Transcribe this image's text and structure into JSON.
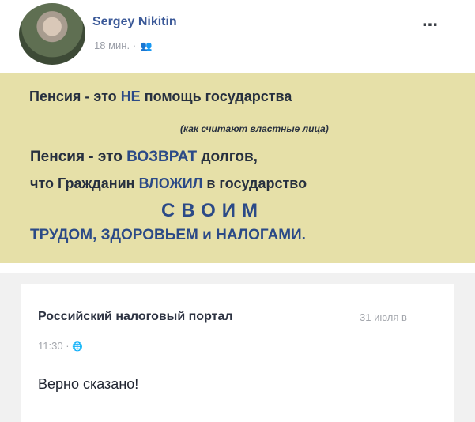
{
  "post": {
    "author": "Sergey Nikitin",
    "time": "18 мин.",
    "separator": "·",
    "privacy_icon": "friends-icon",
    "more_label": "...",
    "banner": {
      "line1_a": "Пенсия - это ",
      "line1_b": "НЕ",
      "line1_c": " помощь государства",
      "line2": "(как считают властные лица)",
      "line3_a": "Пенсия - это ",
      "line3_b": "ВОЗВРАТ",
      "line3_c": " долгов,",
      "line4_a": "что Гражданин ",
      "line4_b": "ВЛОЖИЛ",
      "line4_c": " в государство",
      "line5": "СВОИМ",
      "line6": "ТРУДОМ, ЗДОРОВЬЕМ и НАЛОГАМИ.",
      "background": "#e6e0a8",
      "accent": "#2b4a87"
    }
  },
  "comment": {
    "author": "Российский налоговый портал",
    "date": "31 июля в",
    "time": "11:30",
    "separator": "·",
    "globe_icon": "globe-icon",
    "text": "Верно сказано!"
  }
}
